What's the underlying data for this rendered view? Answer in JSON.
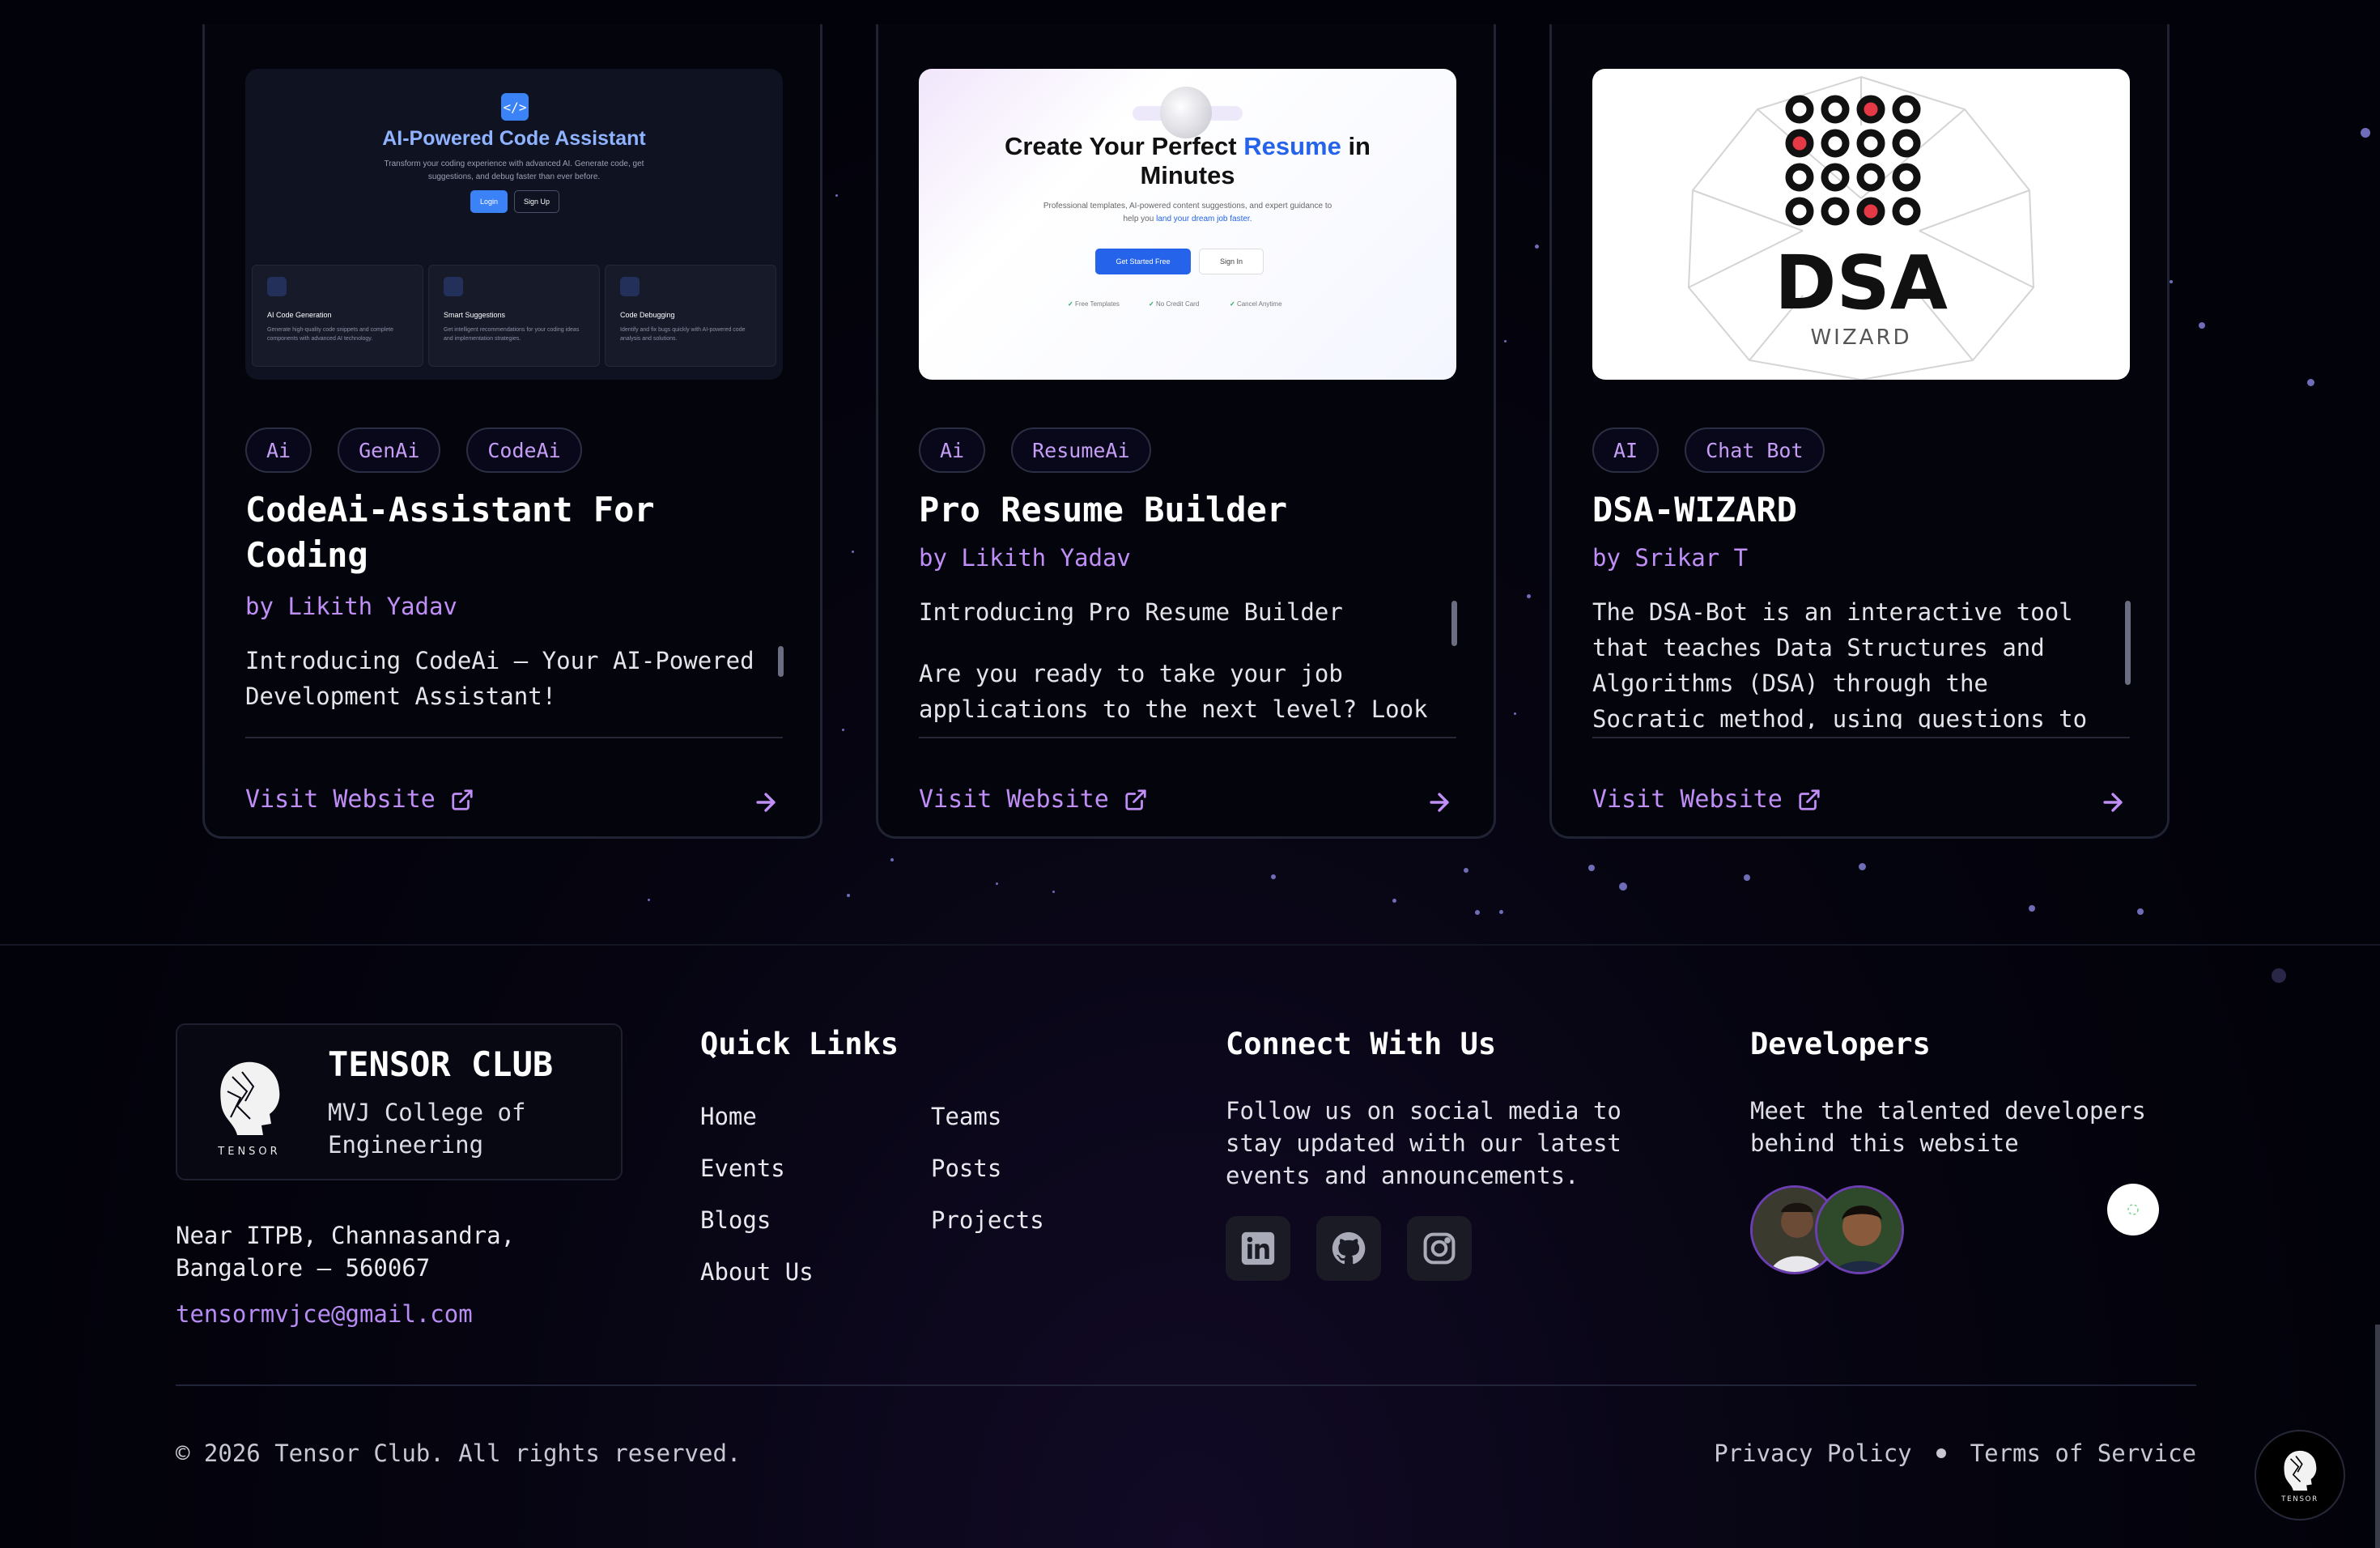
{
  "projects": [
    {
      "tags": [
        "Ai",
        "GenAi",
        "CodeAi"
      ],
      "title": "CodeAi-Assistant For Coding",
      "author": "by Likith Yadav",
      "description": [
        "Introducing CodeAi – Your AI-Powered Development Assistant!"
      ],
      "visit_label": "Visit Website",
      "thumbnail": {
        "title": "AI-Powered Code Assistant",
        "subtitle": "Transform your coding experience with advanced AI. Generate code, get suggestions, and debug faster than ever before.",
        "login": "Login",
        "signup": "Sign Up",
        "features": [
          {
            "title": "AI Code Generation",
            "text": "Generate high-quality code snippets and complete components with advanced AI technology."
          },
          {
            "title": "Smart Suggestions",
            "text": "Get intelligent recommendations for your coding ideas and implementation strategies."
          },
          {
            "title": "Code Debugging",
            "text": "Identify and fix bugs quickly with AI-powered code analysis and solutions."
          }
        ]
      }
    },
    {
      "tags": [
        "Ai",
        "ResumeAi"
      ],
      "title": "Pro Resume Builder",
      "author": "by Likith Yadav",
      "description": [
        "Introducing Pro Resume Builder",
        "Are you ready to take your job applications to the next level? Look"
      ],
      "visit_label": "Visit Website",
      "thumbnail": {
        "title_a": "Create Your Perfect",
        "title_b": "Resume",
        "title_c": "in",
        "title_d": "Minutes",
        "subtitle_a": "Professional templates, AI-powered content suggestions, and expert guidance to help you",
        "subtitle_b": "land your dream job faster.",
        "cta": "Get Started Free",
        "signin": "Sign In",
        "checks": [
          "Free Templates",
          "No Credit Card",
          "Cancel Anytime"
        ]
      }
    },
    {
      "tags": [
        "AI",
        "Chat Bot"
      ],
      "title": "DSA-WIZARD",
      "author": "by Srikar T",
      "description": [
        "The DSA-Bot is an interactive tool that teaches Data Structures and Algorithms (DSA) through the Socratic method, using questions to deepen"
      ],
      "visit_label": "Visit Website",
      "thumbnail": {
        "logo_text": "DSA",
        "logo_sub": "WIZARD"
      }
    }
  ],
  "footer": {
    "brand": {
      "name": "TENSOR CLUB",
      "sub": "MVJ College of Engineering",
      "logo_word": "TENSOR"
    },
    "address": "Near ITPB, Channasandra, Bangalore – 560067",
    "email": "tensormvjce@gmail.com",
    "quick_links": {
      "heading": "Quick Links",
      "col1": [
        "Home",
        "Events",
        "Blogs",
        "About Us"
      ],
      "col2": [
        "Teams",
        "Posts",
        "Projects"
      ]
    },
    "connect": {
      "heading": "Connect With Us",
      "text": "Follow us on social media to stay updated with our latest events and announcements.",
      "icons": [
        "linkedin-icon",
        "github-icon",
        "instagram-icon"
      ]
    },
    "developers": {
      "heading": "Developers",
      "text": "Meet the talented developers behind this website"
    },
    "copyright": "© 2026 Tensor Club. All rights reserved.",
    "privacy": "Privacy Policy",
    "terms": "Terms of Service"
  },
  "colors": {
    "accent": "#c08ef7",
    "background": "#02020a",
    "card_border": "#1f2333"
  }
}
